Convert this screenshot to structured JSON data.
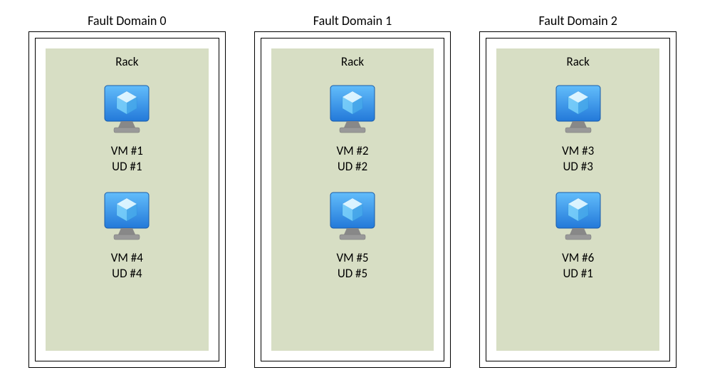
{
  "faultDomains": [
    {
      "title": "Fault Domain 0",
      "rackLabel": "Rack",
      "vms": [
        {
          "vmLabel": "VM #1",
          "udLabel": "UD #1"
        },
        {
          "vmLabel": "VM #4",
          "udLabel": "UD #4"
        }
      ]
    },
    {
      "title": "Fault Domain 1",
      "rackLabel": "Rack",
      "vms": [
        {
          "vmLabel": "VM #2",
          "udLabel": "UD #2"
        },
        {
          "vmLabel": "VM #5",
          "udLabel": "UD #5"
        }
      ]
    },
    {
      "title": "Fault Domain 2",
      "rackLabel": "Rack",
      "vms": [
        {
          "vmLabel": "VM #3",
          "udLabel": "UD #3"
        },
        {
          "vmLabel": "VM #6",
          "udLabel": "UD #1"
        }
      ]
    }
  ],
  "colors": {
    "rackBg": "#d7dec4",
    "monitorTop": "#62bdfb",
    "monitorBottom": "#2379d9",
    "stand": "#888888"
  }
}
